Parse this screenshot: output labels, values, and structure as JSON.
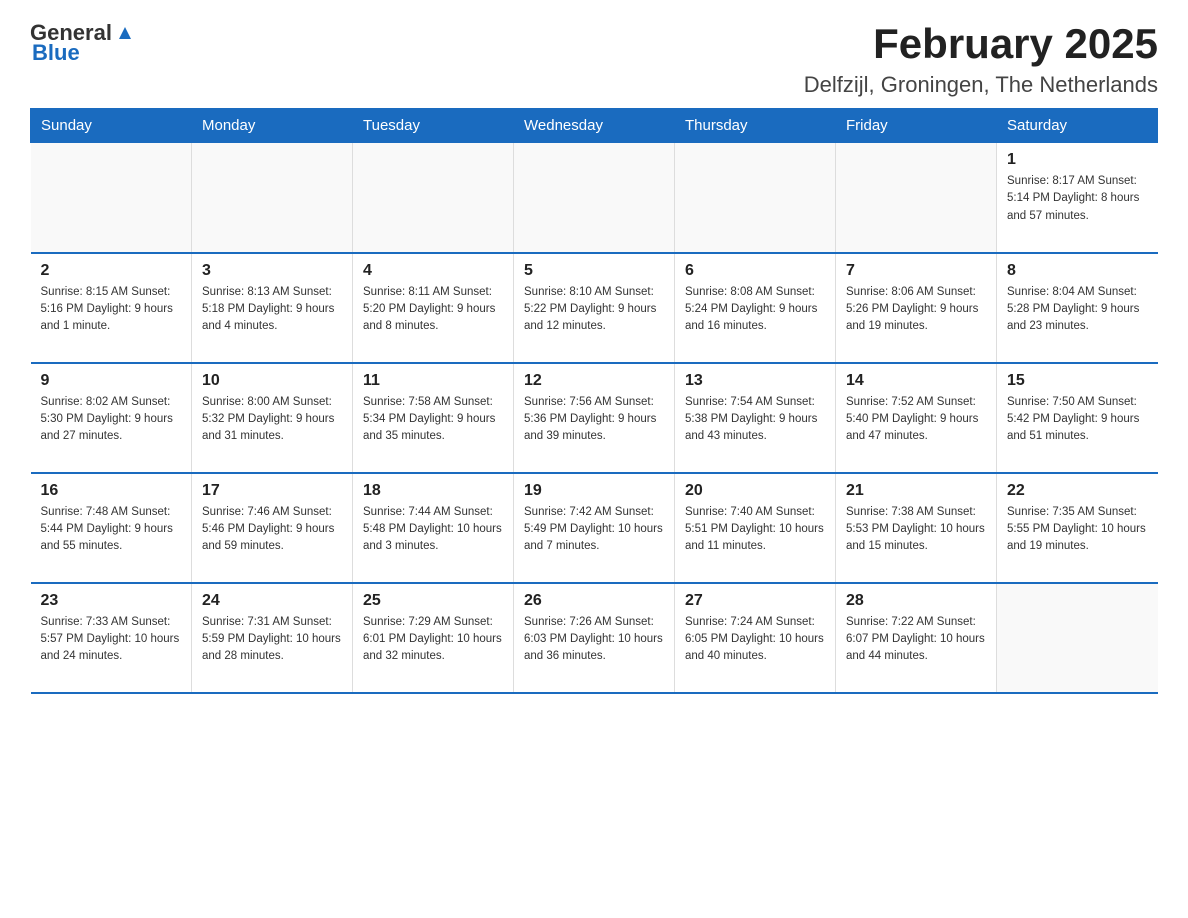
{
  "header": {
    "logo_general": "General",
    "logo_blue": "Blue",
    "title": "February 2025",
    "subtitle": "Delfzijl, Groningen, The Netherlands"
  },
  "days_of_week": [
    "Sunday",
    "Monday",
    "Tuesday",
    "Wednesday",
    "Thursday",
    "Friday",
    "Saturday"
  ],
  "weeks": [
    [
      {
        "day": "",
        "info": ""
      },
      {
        "day": "",
        "info": ""
      },
      {
        "day": "",
        "info": ""
      },
      {
        "day": "",
        "info": ""
      },
      {
        "day": "",
        "info": ""
      },
      {
        "day": "",
        "info": ""
      },
      {
        "day": "1",
        "info": "Sunrise: 8:17 AM\nSunset: 5:14 PM\nDaylight: 8 hours\nand 57 minutes."
      }
    ],
    [
      {
        "day": "2",
        "info": "Sunrise: 8:15 AM\nSunset: 5:16 PM\nDaylight: 9 hours\nand 1 minute."
      },
      {
        "day": "3",
        "info": "Sunrise: 8:13 AM\nSunset: 5:18 PM\nDaylight: 9 hours\nand 4 minutes."
      },
      {
        "day": "4",
        "info": "Sunrise: 8:11 AM\nSunset: 5:20 PM\nDaylight: 9 hours\nand 8 minutes."
      },
      {
        "day": "5",
        "info": "Sunrise: 8:10 AM\nSunset: 5:22 PM\nDaylight: 9 hours\nand 12 minutes."
      },
      {
        "day": "6",
        "info": "Sunrise: 8:08 AM\nSunset: 5:24 PM\nDaylight: 9 hours\nand 16 minutes."
      },
      {
        "day": "7",
        "info": "Sunrise: 8:06 AM\nSunset: 5:26 PM\nDaylight: 9 hours\nand 19 minutes."
      },
      {
        "day": "8",
        "info": "Sunrise: 8:04 AM\nSunset: 5:28 PM\nDaylight: 9 hours\nand 23 minutes."
      }
    ],
    [
      {
        "day": "9",
        "info": "Sunrise: 8:02 AM\nSunset: 5:30 PM\nDaylight: 9 hours\nand 27 minutes."
      },
      {
        "day": "10",
        "info": "Sunrise: 8:00 AM\nSunset: 5:32 PM\nDaylight: 9 hours\nand 31 minutes."
      },
      {
        "day": "11",
        "info": "Sunrise: 7:58 AM\nSunset: 5:34 PM\nDaylight: 9 hours\nand 35 minutes."
      },
      {
        "day": "12",
        "info": "Sunrise: 7:56 AM\nSunset: 5:36 PM\nDaylight: 9 hours\nand 39 minutes."
      },
      {
        "day": "13",
        "info": "Sunrise: 7:54 AM\nSunset: 5:38 PM\nDaylight: 9 hours\nand 43 minutes."
      },
      {
        "day": "14",
        "info": "Sunrise: 7:52 AM\nSunset: 5:40 PM\nDaylight: 9 hours\nand 47 minutes."
      },
      {
        "day": "15",
        "info": "Sunrise: 7:50 AM\nSunset: 5:42 PM\nDaylight: 9 hours\nand 51 minutes."
      }
    ],
    [
      {
        "day": "16",
        "info": "Sunrise: 7:48 AM\nSunset: 5:44 PM\nDaylight: 9 hours\nand 55 minutes."
      },
      {
        "day": "17",
        "info": "Sunrise: 7:46 AM\nSunset: 5:46 PM\nDaylight: 9 hours\nand 59 minutes."
      },
      {
        "day": "18",
        "info": "Sunrise: 7:44 AM\nSunset: 5:48 PM\nDaylight: 10 hours\nand 3 minutes."
      },
      {
        "day": "19",
        "info": "Sunrise: 7:42 AM\nSunset: 5:49 PM\nDaylight: 10 hours\nand 7 minutes."
      },
      {
        "day": "20",
        "info": "Sunrise: 7:40 AM\nSunset: 5:51 PM\nDaylight: 10 hours\nand 11 minutes."
      },
      {
        "day": "21",
        "info": "Sunrise: 7:38 AM\nSunset: 5:53 PM\nDaylight: 10 hours\nand 15 minutes."
      },
      {
        "day": "22",
        "info": "Sunrise: 7:35 AM\nSunset: 5:55 PM\nDaylight: 10 hours\nand 19 minutes."
      }
    ],
    [
      {
        "day": "23",
        "info": "Sunrise: 7:33 AM\nSunset: 5:57 PM\nDaylight: 10 hours\nand 24 minutes."
      },
      {
        "day": "24",
        "info": "Sunrise: 7:31 AM\nSunset: 5:59 PM\nDaylight: 10 hours\nand 28 minutes."
      },
      {
        "day": "25",
        "info": "Sunrise: 7:29 AM\nSunset: 6:01 PM\nDaylight: 10 hours\nand 32 minutes."
      },
      {
        "day": "26",
        "info": "Sunrise: 7:26 AM\nSunset: 6:03 PM\nDaylight: 10 hours\nand 36 minutes."
      },
      {
        "day": "27",
        "info": "Sunrise: 7:24 AM\nSunset: 6:05 PM\nDaylight: 10 hours\nand 40 minutes."
      },
      {
        "day": "28",
        "info": "Sunrise: 7:22 AM\nSunset: 6:07 PM\nDaylight: 10 hours\nand 44 minutes."
      },
      {
        "day": "",
        "info": ""
      }
    ]
  ]
}
